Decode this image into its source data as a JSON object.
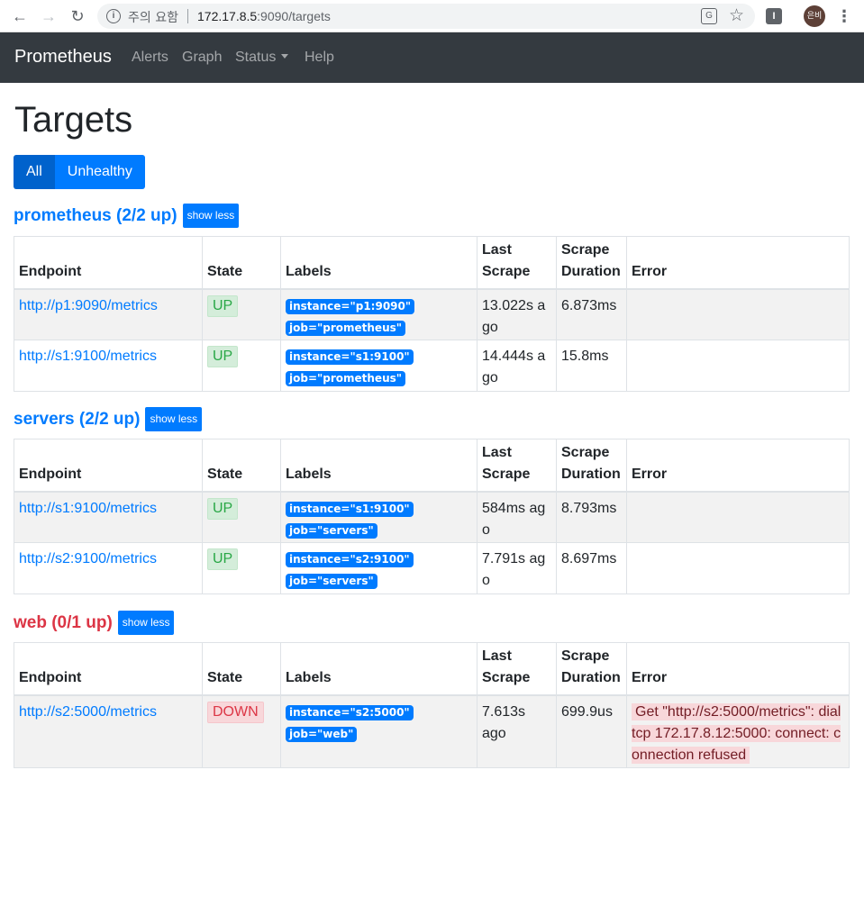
{
  "browser": {
    "warning": "주의 요함",
    "url_host": "172.17.8.5",
    "url_rest": ":9090/targets",
    "avatar_text": "은비"
  },
  "navbar": {
    "brand": "Prometheus",
    "links": [
      "Alerts",
      "Graph",
      "Status",
      "Help"
    ]
  },
  "page": {
    "title": "Targets",
    "filters": [
      "All",
      "Unhealthy"
    ]
  },
  "columns": {
    "endpoint": "Endpoint",
    "state": "State",
    "labels": "Labels",
    "last_scrape_1": "Last",
    "last_scrape_2": "Scrape",
    "duration_1": "Scrape",
    "duration_2": "Duration",
    "error": "Error"
  },
  "pools": [
    {
      "title": "prometheus (2/2 up)",
      "toggle": "show less",
      "targets": [
        {
          "endpoint": "http://p1:9090/metrics",
          "state": "UP",
          "labels": [
            "instance=\"p1:9090\"",
            "job=\"prometheus\""
          ],
          "last_scrape": "13.022s ago",
          "duration": "6.873ms",
          "error": ""
        },
        {
          "endpoint": "http://s1:9100/metrics",
          "state": "UP",
          "labels": [
            "instance=\"s1:9100\"",
            "job=\"prometheus\""
          ],
          "last_scrape": "14.444s ago",
          "duration": "15.8ms",
          "error": ""
        }
      ]
    },
    {
      "title": "servers (2/2 up)",
      "toggle": "show less",
      "targets": [
        {
          "endpoint": "http://s1:9100/metrics",
          "state": "UP",
          "labels": [
            "instance=\"s1:9100\"",
            "job=\"servers\""
          ],
          "last_scrape": "584ms ago",
          "duration": "8.793ms",
          "error": ""
        },
        {
          "endpoint": "http://s2:9100/metrics",
          "state": "UP",
          "labels": [
            "instance=\"s2:9100\"",
            "job=\"servers\""
          ],
          "last_scrape": "7.791s ago",
          "duration": "8.697ms",
          "error": ""
        }
      ]
    },
    {
      "title": "web (0/1 up)",
      "toggle": "show less",
      "targets": [
        {
          "endpoint": "http://s2:5000/metrics",
          "state": "DOWN",
          "labels": [
            "instance=\"s2:5000\"",
            "job=\"web\""
          ],
          "last_scrape": "7.613s ago",
          "duration": "699.9us",
          "error": "Get \"http://s2:5000/metrics\": dial tcp 172.17.8.12:5000: connect: connection refused"
        }
      ]
    }
  ],
  "colors": {
    "primary": "#007bff",
    "danger": "#dc3545",
    "navbar": "#343a40"
  }
}
